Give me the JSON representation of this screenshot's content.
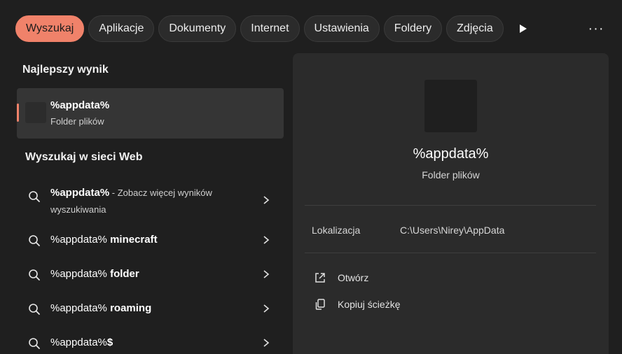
{
  "tabs": [
    {
      "label": "Wyszukaj",
      "active": true
    },
    {
      "label": "Aplikacje",
      "active": false
    },
    {
      "label": "Dokumenty",
      "active": false
    },
    {
      "label": "Internet",
      "active": false
    },
    {
      "label": "Ustawienia",
      "active": false
    },
    {
      "label": "Foldery",
      "active": false
    },
    {
      "label": "Zdjęcia",
      "active": false
    }
  ],
  "more_label": "···",
  "best_section_title": "Najlepszy wynik",
  "best_result": {
    "name": "%appdata%",
    "type": "Folder plików"
  },
  "web_section_title": "Wyszukaj w sieci Web",
  "web_items": [
    {
      "query": "%appdata%",
      "suffix": "",
      "hint": " - Zobacz więcej wyników wyszukiwania"
    },
    {
      "query": "%appdata%",
      "suffix": " minecraft",
      "hint": ""
    },
    {
      "query": "%appdata%",
      "suffix": " folder",
      "hint": ""
    },
    {
      "query": "%appdata%",
      "suffix": " roaming",
      "hint": ""
    },
    {
      "query": "%appdata%",
      "suffix": "$",
      "hint": ""
    }
  ],
  "detail": {
    "title": "%appdata%",
    "subtitle": "Folder plików",
    "location_label": "Lokalizacja",
    "location_value": "C:\\Users\\Nirey\\AppData",
    "actions": [
      {
        "label": "Otwórz",
        "icon": "open-external-icon"
      },
      {
        "label": "Kopiuj ścieżkę",
        "icon": "copy-icon"
      }
    ]
  },
  "colors": {
    "accent": "#f0826a",
    "background": "#1f1f1f",
    "panel": "#2b2b2b"
  }
}
